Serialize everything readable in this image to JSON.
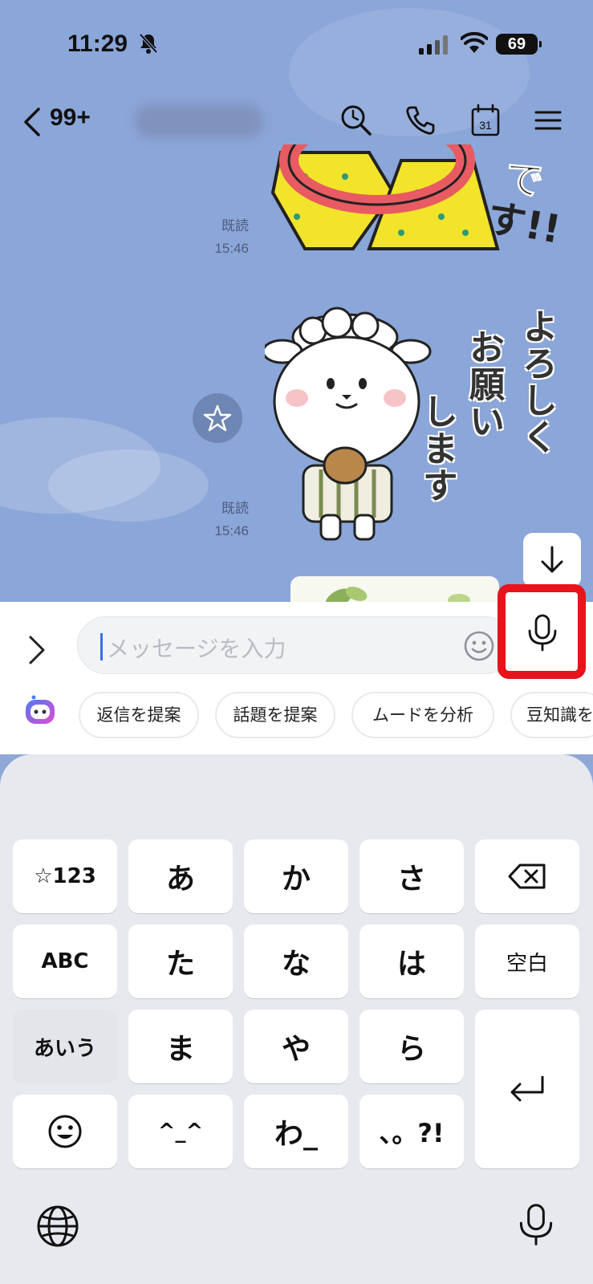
{
  "status_bar": {
    "time": "11:29",
    "battery": "69"
  },
  "nav": {
    "unread_count": "99+"
  },
  "messages": [
    {
      "read_label": "既読",
      "time": "15:46"
    },
    {
      "read_label": "既読",
      "time": "15:46"
    }
  ],
  "sticker_text": {
    "col1": "よろしく",
    "col2": "お願い",
    "col3": "します",
    "top": "です!!"
  },
  "input": {
    "placeholder": "メッセージを入力"
  },
  "suggestions": [
    "返信を提案",
    "話題を提案",
    "ムードを分析",
    "豆知識を"
  ],
  "keyboard": {
    "row1": [
      "☆123",
      "あ",
      "か",
      "さ"
    ],
    "row2": [
      "ABC",
      "た",
      "な",
      "は",
      "空白"
    ],
    "row3": [
      "あいう",
      "ま",
      "や",
      "ら"
    ],
    "row4": [
      "^_^",
      "わ_",
      "、。?!"
    ]
  },
  "colors": {
    "accent_highlight": "#e8131b",
    "chat_bg": "#8ba6d8",
    "caret": "#3b6de8"
  }
}
